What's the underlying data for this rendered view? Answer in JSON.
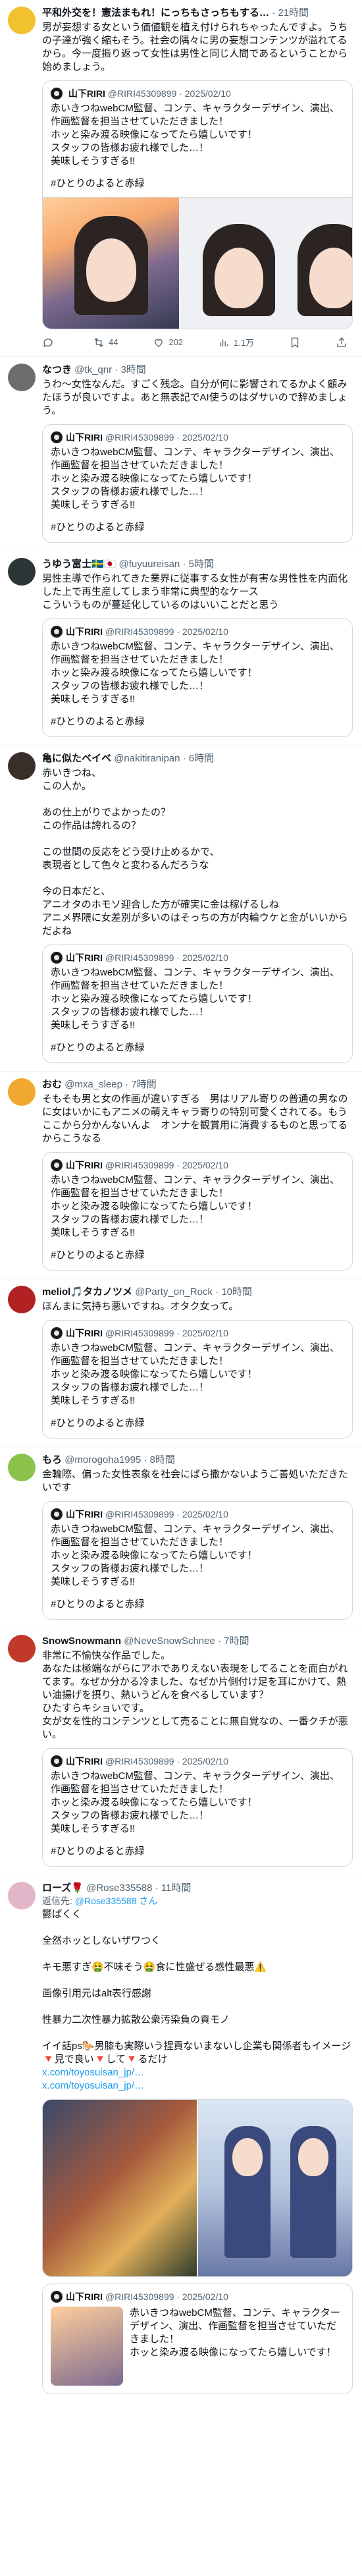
{
  "quote": {
    "name": "山下RIRI",
    "handle": "@RIRI45309899",
    "date": "2025/02/10",
    "text": "赤いきつねwebCM監督、コンテ、キャラクターデザイン、演出、作画監督を担当させていただきました！\nホッと染み渡る映像になってたら嬉しいです！\nスタッフの皆様お疲れ様でした…！\n美味しそうすぎる!!",
    "text_narrow": "赤いきつねwebCM監督、コンテ、キャラクターデザイン、演出、作画監督を担当させていただきました！\nホッと染み渡る映像になってたら嬉しいです！",
    "hashtag": "#ひとりのよると赤緑"
  },
  "posts": [
    {
      "name": "平和外交を！憲法まもれ！にっちもさっちもする…",
      "handle": "",
      "time": "21時間",
      "text": "男が妄想する女という価値観を植え付けられちゃったんですよ。うちの子達が強く縮もそう。社会の隅々に男の妄想コンテンツが溢れてるから。今一度振り返って女性は男性と同じ人間であるということから始めましょう。",
      "avatar_color": "#f2c12e",
      "has_media": true,
      "stats": {
        "replies": "",
        "retweets": "44",
        "likes": "202",
        "views": "1.1万"
      }
    },
    {
      "name": "なつき",
      "handle": "@tk_qnr",
      "time": "3時間",
      "text": "うわ〜女性なんだ。すごく残念。自分が何に影響されてるかよく顧みたほうが良いですよ。あと無表記でAI使うのはダサいので辞めましょう。",
      "avatar_color": "#6c6c6c"
    },
    {
      "name": "うゆう富士🇸🇪🇯🇵",
      "handle": "@fuyuureisan",
      "time": "5時間",
      "text": "男性主導で作られてきた業界に従事する女性が有害な男性性を内面化した上で再生産してしまう非常に典型的なケース\nこういうものが蔓延化しているのはいいことだと思う",
      "avatar_color": "#2d3436"
    },
    {
      "name": "亀に似たベイベ",
      "handle": "@nakitiranipan",
      "time": "6時間",
      "text": "赤いきつね、\nこの人か。\n\nあの仕上がりでよかったの？\nこの作品は誇れるの？\n\nこの世間の反応をどう受け止めるかで、\n表現者として色々と変わるんだろうな\n\n今の日本だと、\nアニオタのホモソ迎合した方が確実に金は稼げるしね\nアニメ界隈に女差別が多いのはそっちの方が内輪ウケと金がいいからだよね",
      "avatar_color": "#3a2e2a"
    },
    {
      "name": "おむ",
      "handle": "@mxa_sleep",
      "time": "7時間",
      "text": "そもそも男と女の作画が違いすぎる　男はリアル寄りの普通の男なのに女はいかにもアニメの萌えキャラ寄りの特別可愛くされてる。もうここから分かんないんよ　オンナを観賞用に消費するものと思ってるからこうなる",
      "avatar_color": "#f0a830"
    },
    {
      "name": "meliol🎵タカノツメ",
      "handle": "@Party_on_Rock",
      "time": "10時間",
      "text": "ほんまに気持ち悪いですね。オタク女って。",
      "avatar_color": "#b22222"
    },
    {
      "name": "もろ",
      "handle": "@morogoha1995",
      "time": "8時間",
      "text": "金輪際、偏った女性表象を社会にばら撒かないようご善処いただきたいです",
      "avatar_color": "#8bc34a"
    },
    {
      "name": "SnowSnowmann",
      "handle": "@NeveSnowSchnee",
      "time": "7時間",
      "text": "非常に不愉快な作品でした。\nあなたは極端ながらにアホでありえない表現をしてることを面白がれてます。なぜか分かる冷ました、なぜか片側付け足を耳にかけて、熱い油揚げを摂り、熱いうどんを食べるしています？\nひたすらキショいです。\n女が女を性的コンテンツとして売ることに無自覚なの、一番クチが悪い。",
      "avatar_color": "#c0392b"
    },
    {
      "name": "ローズ🌹",
      "handle": "@Rose335588",
      "time": "11時間",
      "reply_label": "返信先: ",
      "reply_handle": "@Rose335588 さん",
      "text": "鬱ぱくく\n\n全然ホッとしないザワつく\n\nキモ悪すぎ🤮不味そう🤮食に性盛ぜる感性最悪⚠️\n\n画像引用元はalt表行感謝\n\n性暴力二次性暴力拡散公衆汚染負の貢モノ\n\nイイ話ps🐎男膝も実際いう捏貢ないまないし企業も関係者もイメージ🔻見で良い🔻して🔻るだけ",
      "link1": "x.com/toyosuisan_jp/…",
      "link2": "x.com/toyosuisan_jp/…",
      "avatar_color": "#e2b5c8"
    }
  ],
  "icons": {
    "reply": "reply-icon",
    "retweet": "retweet-icon",
    "like": "heart-icon",
    "views": "views-icon",
    "bookmark": "bookmark-icon",
    "share": "share-icon"
  },
  "colors": {
    "link": "#1d9bf0",
    "text": "#0f1419",
    "muted": "#536471",
    "border": "#cfd9de"
  }
}
